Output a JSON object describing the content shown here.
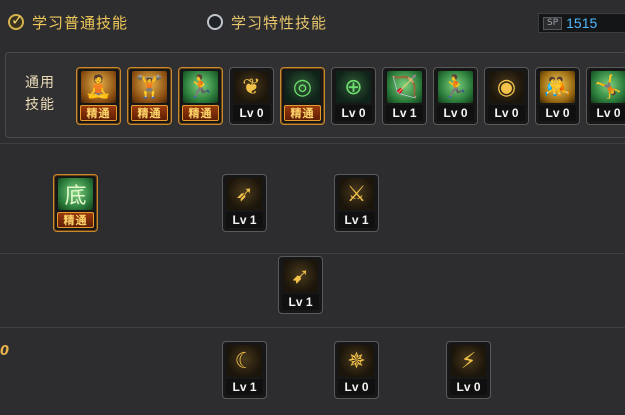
{
  "tabs": [
    {
      "label": "学习普通技能",
      "active": true
    },
    {
      "label": "学习特性技能",
      "active": false
    }
  ],
  "sp": {
    "label": "SP",
    "value": "1515"
  },
  "common": {
    "label_line1": "通用",
    "label_line2": "技能"
  },
  "common_skills": [
    {
      "icon": "sit-figure-icon",
      "glyph": "🧘",
      "style": "g-orange",
      "level": "精通",
      "mastered": true
    },
    {
      "icon": "crouch-figure-icon",
      "glyph": "🏋",
      "style": "g-orange",
      "level": "精通",
      "mastered": true
    },
    {
      "icon": "dash-figure-icon",
      "glyph": "🏃",
      "style": "g-green",
      "level": "精通",
      "mastered": true
    },
    {
      "icon": "wings-icon",
      "glyph": "❦",
      "style": "g-dark",
      "level": "Lv 0",
      "mastered": false
    },
    {
      "icon": "target-icon",
      "glyph": "◎",
      "style": "g-darkgreen",
      "level": "精通",
      "mastered": true
    },
    {
      "icon": "crosshair-icon",
      "glyph": "⊕",
      "style": "g-darkgreen",
      "level": "Lv 0",
      "mastered": false
    },
    {
      "icon": "archer-icon",
      "glyph": "🏹",
      "style": "g-green",
      "level": "Lv 1",
      "mastered": false
    },
    {
      "icon": "runner-icon",
      "glyph": "🏃",
      "style": "g-green",
      "level": "Lv 0",
      "mastered": false
    },
    {
      "icon": "eye-icon",
      "glyph": "◉",
      "style": "g-dark",
      "level": "Lv 0",
      "mastered": false
    },
    {
      "icon": "fighter-icon",
      "glyph": "🤼",
      "style": "g-yellow",
      "level": "Lv 0",
      "mastered": false
    },
    {
      "icon": "leap-icon",
      "glyph": "🤸",
      "style": "g-green",
      "level": "Lv 0",
      "mastered": false
    }
  ],
  "tree_skills": [
    {
      "icon": "base-skill-icon",
      "glyph": "底",
      "style": "g-green",
      "level": "精通",
      "mastered": true
    },
    {
      "icon": "arrow-shot-icon",
      "glyph": "➶",
      "style": "g-dark",
      "level": "Lv 1",
      "mastered": false
    },
    {
      "icon": "sickle-icon",
      "glyph": "⚔",
      "style": "g-dark",
      "level": "Lv 1",
      "mastered": false
    },
    {
      "icon": "bow-slash-icon",
      "glyph": "➹",
      "style": "g-dark",
      "level": "Lv 1",
      "mastered": false
    },
    {
      "icon": "crescent-icon",
      "glyph": "☾",
      "style": "g-dark",
      "level": "Lv 1",
      "mastered": false
    },
    {
      "icon": "spear-burst-icon",
      "glyph": "✵",
      "style": "g-dark",
      "level": "Lv 0",
      "mastered": false
    },
    {
      "icon": "slash-figure-icon",
      "glyph": "⚡",
      "style": "g-dark",
      "level": "Lv 0",
      "mastered": false
    }
  ],
  "row_marks": [
    "0"
  ],
  "colors": {
    "accent_gold": "#f0c85a",
    "sp_blue": "#4fb9ff",
    "background": "#2d2d2f"
  }
}
